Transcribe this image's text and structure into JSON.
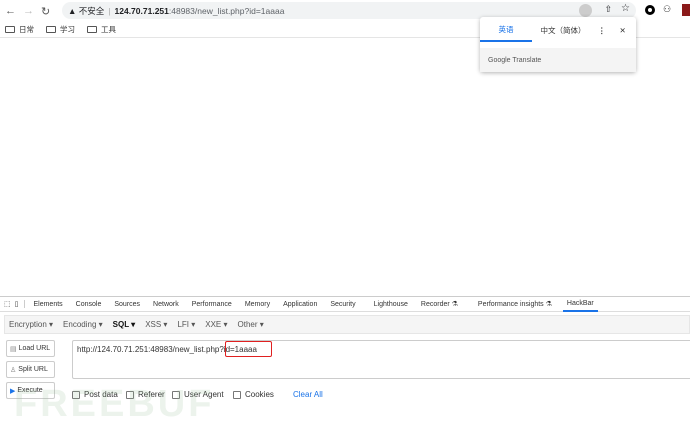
{
  "browser": {
    "insecure_label": "不安全",
    "url_host": "124.70.71.251",
    "url_rest": ":48983/new_list.php?id=1aaaa",
    "bookmarks": [
      "日常",
      "学习",
      "工具"
    ]
  },
  "translate_popup": {
    "tabs": [
      "英语",
      "中文（简体）"
    ],
    "active_tab": 0,
    "footer": "Google Translate"
  },
  "devtools": {
    "tabs": [
      "Elements",
      "Console",
      "Sources",
      "Network",
      "Performance",
      "Memory",
      "Application",
      "Security",
      "Lighthouse",
      "Recorder ⚗",
      "Performance insights ⚗",
      "HackBar"
    ],
    "active_tab": "HackBar"
  },
  "hackbar": {
    "menu": [
      "Encryption ▾",
      "Encoding ▾",
      "SQL ▾",
      "XSS ▾",
      "LFI ▾",
      "XXE ▾",
      "Other ▾"
    ],
    "load_url": "Load URL",
    "split_url": "Split URL",
    "execute": "Execute",
    "url_value": "http://124.70.71.251:48983/new_list.php?id=1aaaa",
    "options": [
      "Post data",
      "Referer",
      "User Agent",
      "Cookies"
    ],
    "clear_all": "Clear All"
  },
  "watermark": "FREEBUF",
  "colors": {
    "accent": "#1a73e8",
    "highlight": "#e02020"
  }
}
